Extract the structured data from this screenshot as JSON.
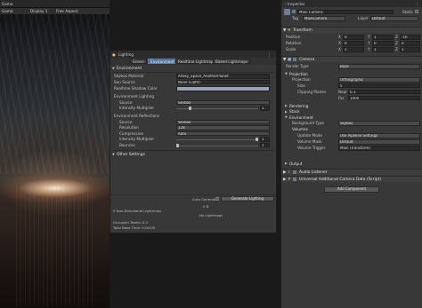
{
  "game": {
    "tab_label": "Game",
    "display": "Display 1",
    "aspect": "Free Aspect"
  },
  "lighting": {
    "title": "Lighting",
    "tabs": [
      "Scene",
      "Environment",
      "Realtime Lightmaps",
      "Baked Lightmaps"
    ],
    "active_tab": "Environment",
    "environment": {
      "header": "Environment",
      "skybox_material_label": "Skybox Material",
      "skybox_material_value": "AllSky_Space_AnotherPlanet",
      "sun_source_label": "Sun Source",
      "sun_source_value": "None (Light)",
      "shadow_color_label": "Realtime Shadow Color",
      "shadow_color": "#9aa3b3",
      "env_lighting_label": "Environment Lighting",
      "source_label": "Source",
      "source_value": "Skybox",
      "intensity_label": "Intensity Multiplier",
      "intensity_value": 1,
      "env_reflections_label": "Environment Reflections",
      "refl_source_label": "Source",
      "refl_source_value": "Skybox",
      "resolution_label": "Resolution",
      "resolution_value": "128",
      "compression_label": "Compression",
      "compression_value": "Auto",
      "refl_intensity_label": "Intensity Multiplier",
      "refl_intensity_value": 1,
      "bounces_label": "Bounces",
      "bounces_value": 1
    },
    "other_settings": "Other Settings",
    "auto_generate_label": "Auto Generate",
    "generate_button": "Generate Lighting",
    "non_directional": "0 Non-Directional Lightmaps",
    "size": "0 B",
    "no_lightmaps": "No Lightmaps",
    "occupied_texels": "Occupied Texels: 0.0",
    "total_bake_time": "Total Bake Time: 0:00:00"
  },
  "inspector": {
    "tab_label": "Inspector",
    "object_name": "Main Camera",
    "static_label": "Static",
    "tag_label": "Tag",
    "tag_value": "MainCamera",
    "layer_label": "Layer",
    "layer_value": "Default",
    "transform": {
      "header": "Transform",
      "rows": [
        {
          "label": "Position",
          "x": "0",
          "y": "1",
          "z": "-10"
        },
        {
          "label": "Rotation",
          "x": "0",
          "y": "0",
          "z": "0"
        },
        {
          "label": "Scale",
          "x": "1",
          "y": "1",
          "z": "1"
        }
      ]
    },
    "camera": {
      "header": "Camera",
      "render_type_label": "Render Type",
      "render_type_value": "Base",
      "projection_header": "Projection",
      "projection_label": "Projection",
      "projection_value": "Orthographic",
      "size_label": "Size",
      "size_value": "5",
      "clipping_label": "Clipping Planes",
      "near_label": "Near",
      "near_value": "0.3",
      "far_label": "Far",
      "far_value": "1000",
      "rendering_header": "Rendering",
      "stack_header": "Stack",
      "environment_header": "Environment",
      "background_type_label": "Background Type",
      "background_type_value": "Skybox",
      "volumes_header": "Volumes",
      "update_mode_label": "Update Mode",
      "update_mode_value": "Use Pipeline Settings",
      "volume_mask_label": "Volume Mask",
      "volume_mask_value": "Default",
      "volume_trigger_label": "Volume Trigger",
      "volume_trigger_value": "Main (Transform)",
      "output_header": "Output"
    },
    "audio_listener": "Audio Listener",
    "additional_camera_data": "Universal Additional Camera Data (Script)",
    "add_component": "Add Component"
  },
  "colors": {
    "accent": "#4b6f9a",
    "panel": "#383838",
    "header": "#2b2b2b"
  }
}
